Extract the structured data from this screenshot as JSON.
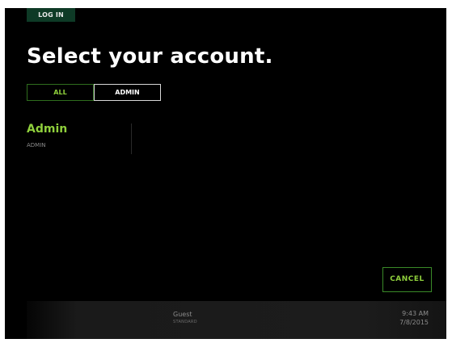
{
  "top_tab": {
    "label": "LOG IN"
  },
  "title": "Select your account.",
  "filters": {
    "all_label": "ALL",
    "admin_label": "ADMIN",
    "selected": "ADMIN"
  },
  "accounts": [
    {
      "name": "Admin",
      "role": "ADMIN"
    }
  ],
  "cancel_label": "CANCEL",
  "status_bar": {
    "user_name": "Guest",
    "user_type": "STANDARD",
    "time": "9:43 AM",
    "date": "7/8/2015"
  },
  "colors": {
    "accent": "#8fcf3c",
    "background": "#000000",
    "tab": "#0e3a26"
  }
}
